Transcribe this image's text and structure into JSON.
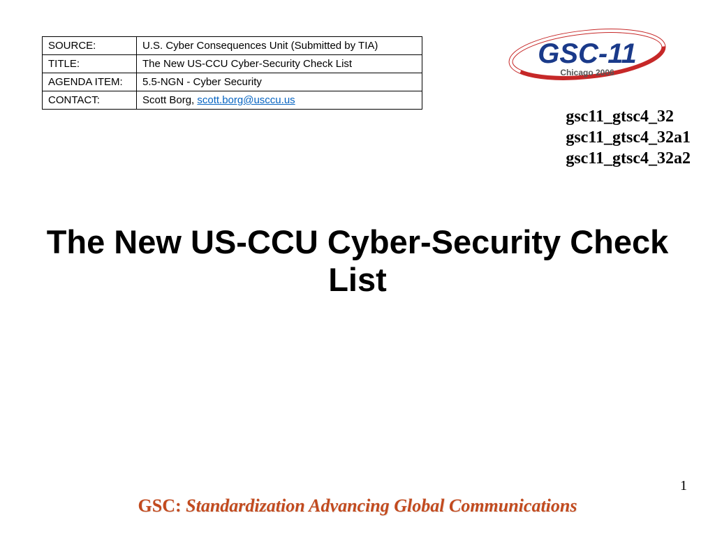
{
  "meta": {
    "rows": [
      {
        "key": "SOURCE:",
        "value": "U.S. Cyber Consequences Unit (Submitted by TIA)"
      },
      {
        "key": "TITLE:",
        "value": "The New US-CCU Cyber-Security Check List"
      },
      {
        "key": "AGENDA ITEM:",
        "value": "5.5-NGN - Cyber Security"
      },
      {
        "key": "CONTACT:",
        "value_prefix": "Scott Borg, ",
        "link_text": "scott.borg@usccu.us"
      }
    ]
  },
  "logo": {
    "brand": "GSC-11",
    "subtext": "Chicago 2006"
  },
  "doc_codes": [
    "gsc11_gtsc4_32",
    "gsc11_gtsc4_32a1",
    "gsc11_gtsc4_32a2"
  ],
  "title": "The New US-CCU Cyber-Security Check List",
  "footer": {
    "lead": "GSC:",
    "rest": " Standardization Advancing Global Communications"
  },
  "page_number": "1"
}
